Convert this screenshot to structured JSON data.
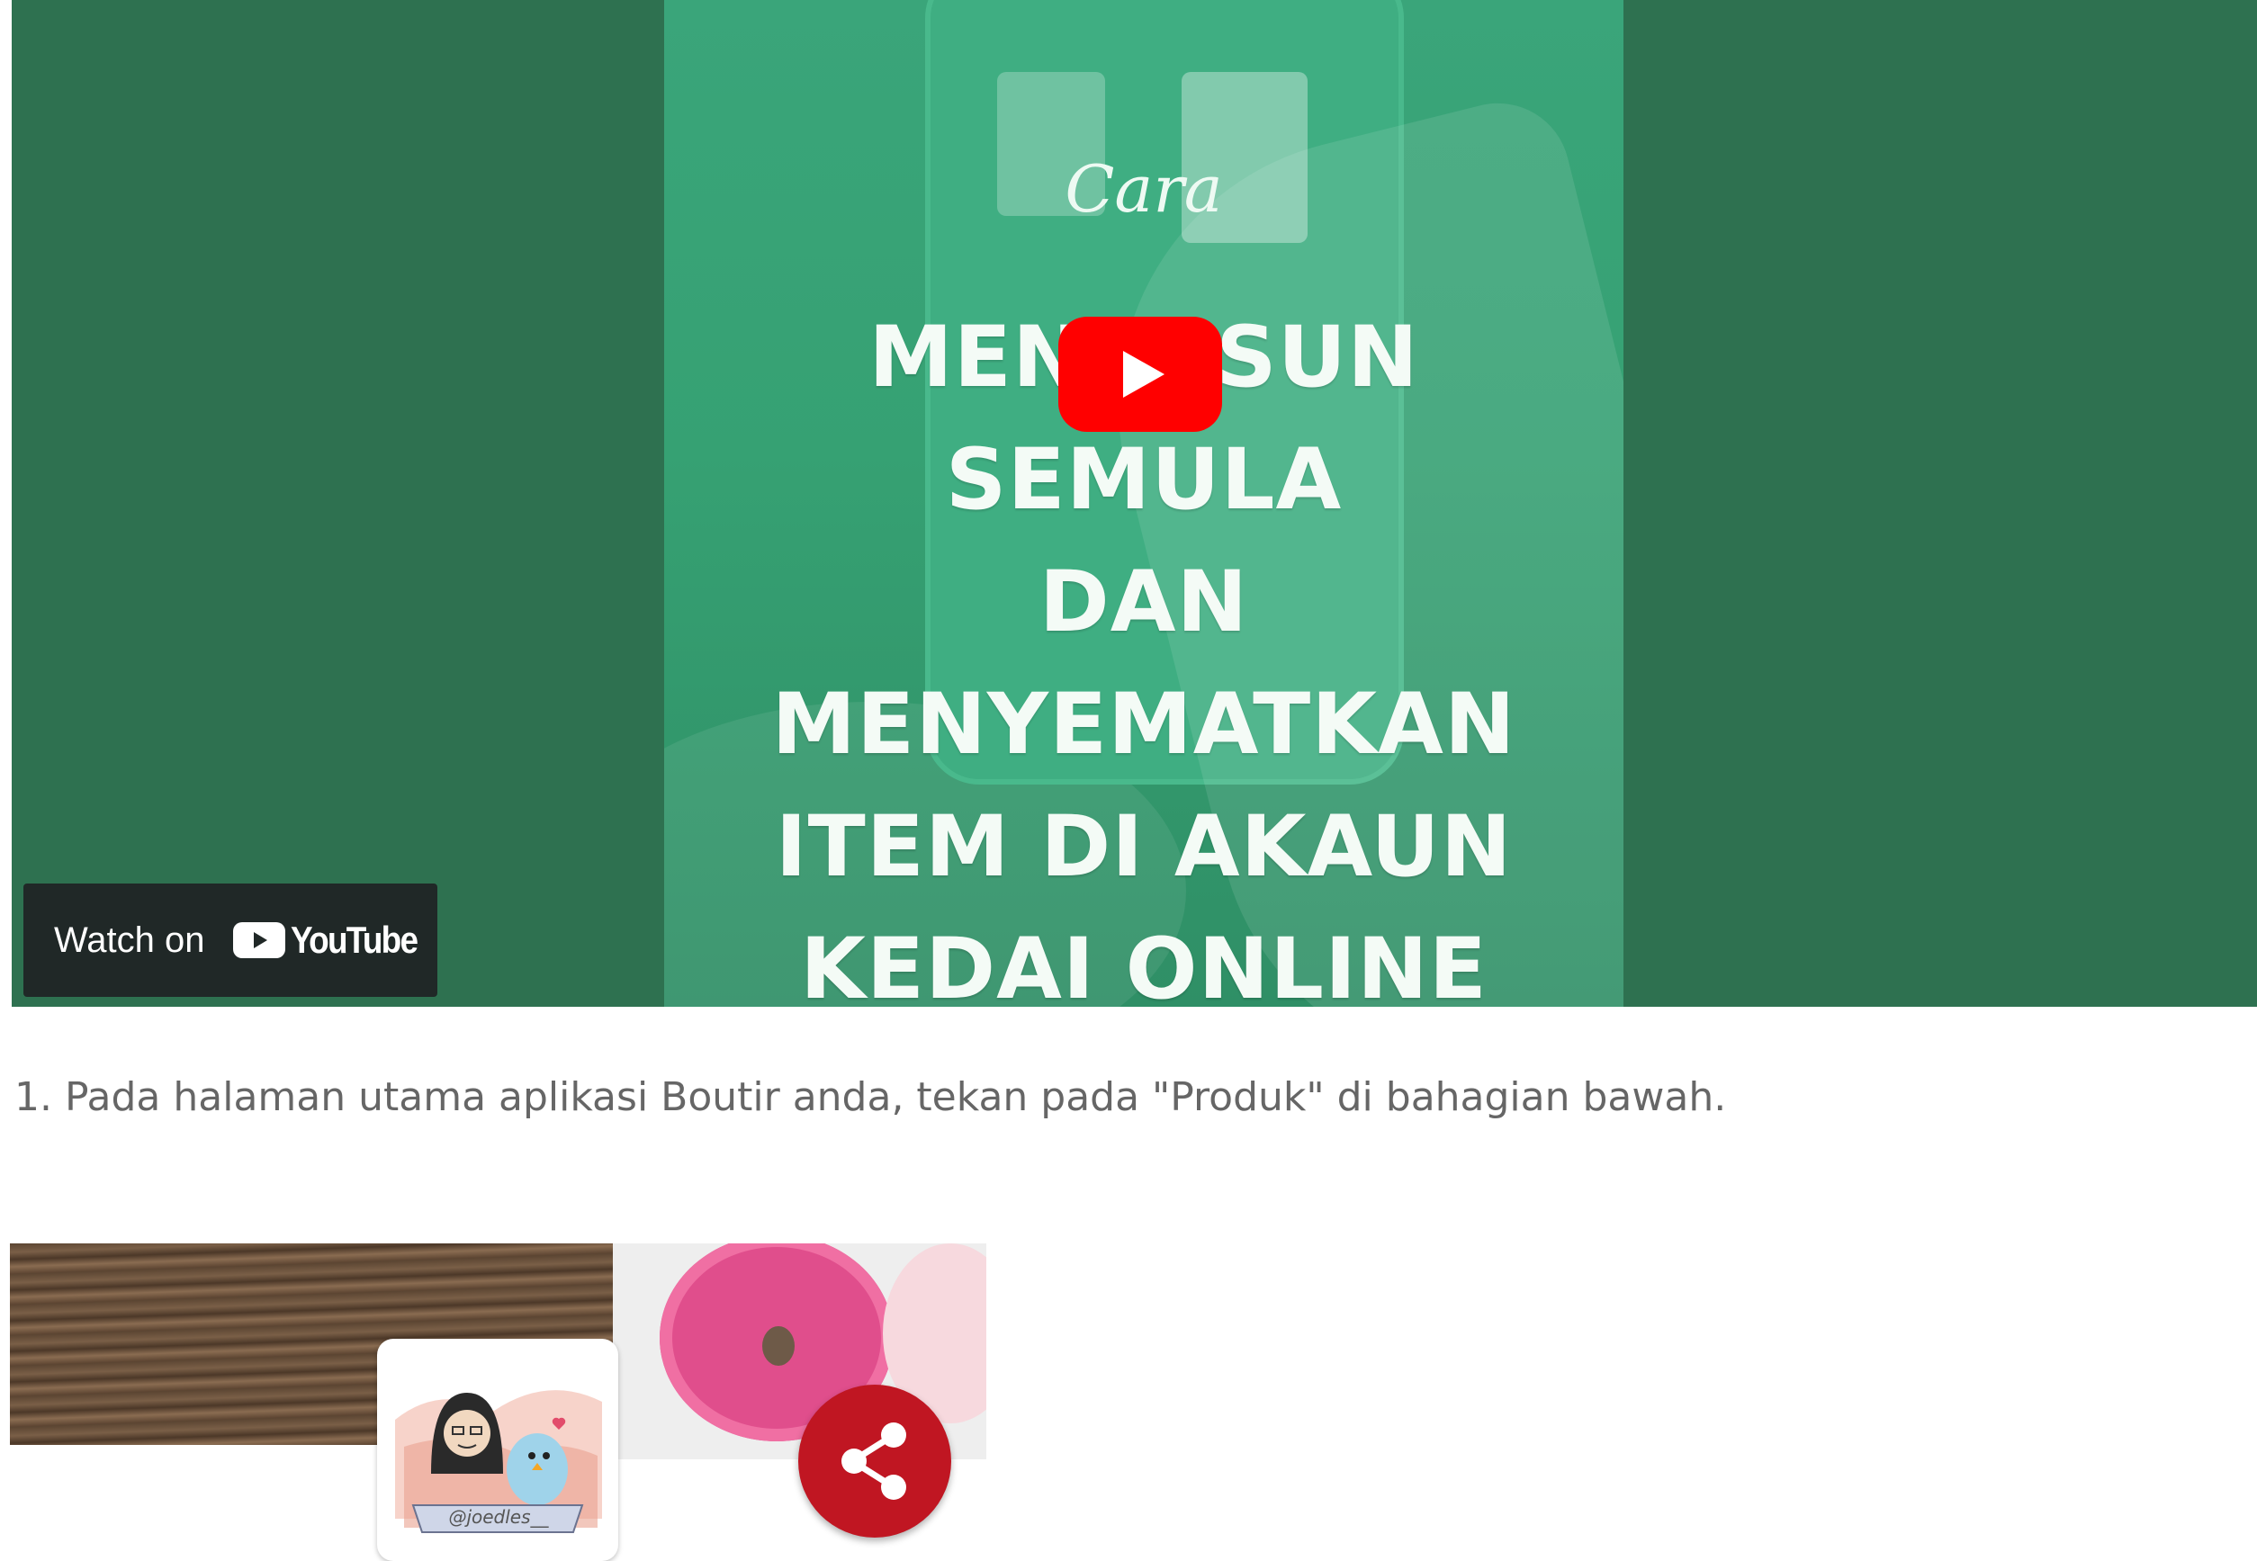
{
  "video": {
    "thumbnail_small_text": "Cara",
    "thumbnail_title_lines": [
      "MENYUSUN SEMULA",
      "DAN MENYEMATKAN",
      "ITEM DI AKAUN",
      "KEDAI ONLINE ANDA"
    ],
    "watch_on_label": "Watch on",
    "youtube_wordmark": "YouTube",
    "play_icon": "play-icon",
    "colors": {
      "background": "#2e7150",
      "play_button": "#ff0000"
    }
  },
  "step": {
    "text": "1. Pada halaman utama aplikasi Boutir anda, tekan pada \"Produk\" di bahagian bawah."
  },
  "preview": {
    "profile_handle": "@joedles__",
    "share_icon": "share-icon",
    "colors": {
      "share_button": "#c01622"
    }
  }
}
